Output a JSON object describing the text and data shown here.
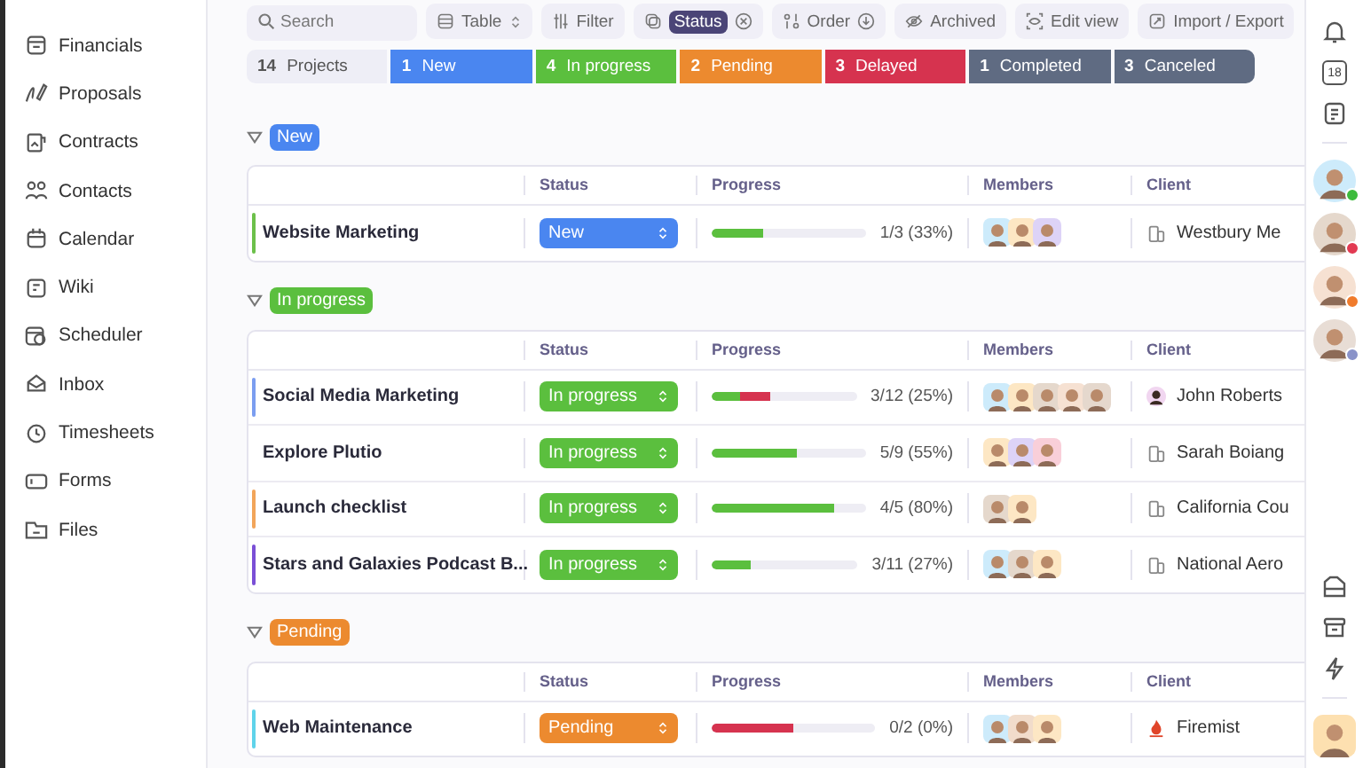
{
  "sidebar": {
    "items": [
      {
        "label": "Financials",
        "kind": "wallet"
      },
      {
        "label": "Proposals",
        "kind": "pen"
      },
      {
        "label": "Contracts",
        "kind": "document"
      },
      {
        "label": "Contacts",
        "kind": "people"
      },
      {
        "label": "Calendar",
        "kind": "calendar"
      },
      {
        "label": "Wiki",
        "kind": "note"
      },
      {
        "label": "Scheduler",
        "kind": "calendar-clock"
      },
      {
        "label": "Inbox",
        "kind": "inbox"
      },
      {
        "label": "Timesheets",
        "kind": "clock"
      },
      {
        "label": "Forms",
        "kind": "form"
      },
      {
        "label": "Files",
        "kind": "folder"
      }
    ]
  },
  "toolbar": {
    "search": {
      "placeholder": "Search"
    },
    "view": {
      "label": "Table"
    },
    "filter": {
      "label": "Filter"
    },
    "active_filter": {
      "label": "Status"
    },
    "order": {
      "label": "Order"
    },
    "archived": {
      "label": "Archived"
    },
    "edit_view": {
      "label": "Edit view"
    },
    "import_export": {
      "label": "Import / Export"
    }
  },
  "summary": [
    {
      "count": "14",
      "label": "Projects",
      "kind": "total"
    },
    {
      "count": "1",
      "label": "New",
      "kind": "new"
    },
    {
      "count": "4",
      "label": "In progress",
      "kind": "progress"
    },
    {
      "count": "2",
      "label": "Pending",
      "kind": "pending"
    },
    {
      "count": "3",
      "label": "Delayed",
      "kind": "delayed"
    },
    {
      "count": "1",
      "label": "Completed",
      "kind": "done"
    },
    {
      "count": "3",
      "label": "Canceled",
      "kind": "done"
    }
  ],
  "groups": [
    {
      "title": "New",
      "kind": "new",
      "expanded": true,
      "columns": [
        "Status",
        "Progress",
        "Members",
        "Client"
      ],
      "rows": [
        {
          "name": "Website Marketing",
          "color": "#6cc04a",
          "status": "New",
          "bar": [
            {
              "level": 0.33,
              "color": "#5bbf3e"
            }
          ],
          "progress": "1/3 (33%)",
          "members": [
            {
              "color": "#cdebfb"
            },
            {
              "color": "#fde7c4"
            },
            {
              "color": "#ddd3f7"
            }
          ],
          "client": {
            "name": "Westbury Me",
            "kind": "company"
          }
        }
      ]
    },
    {
      "title": "In progress",
      "kind": "progress",
      "expanded": true,
      "columns": [
        "Status",
        "Progress",
        "Members",
        "Client"
      ],
      "rows": [
        {
          "name": "Social Media Marketing",
          "color": "#7b9df0",
          "status": "In progress",
          "bar": [
            {
              "level": 0.2,
              "color": "#5bbf3e"
            },
            {
              "level": 0.2,
              "color": "#d6334f"
            }
          ],
          "progress": "3/12 (25%)",
          "members": [
            {
              "color": "#cdebfb"
            },
            {
              "color": "#fde7c4"
            },
            {
              "color": "#e5d8cc"
            },
            {
              "color": "#f6e1d2"
            },
            {
              "color": "#e5d8cd"
            }
          ],
          "client": {
            "name": "John Roberts",
            "kind": "person"
          }
        },
        {
          "name": "Explore Plutio",
          "status": "In progress",
          "bar": [
            {
              "level": 0.55,
              "color": "#5bbf3e"
            }
          ],
          "progress": "5/9 (55%)",
          "members": [
            {
              "color": "#fde7c4"
            },
            {
              "color": "#ddd3f7"
            },
            {
              "color": "#f9cfd9"
            }
          ],
          "client": {
            "name": "Sarah Boiang",
            "kind": "company"
          }
        },
        {
          "name": "Launch checklist",
          "color": "#f2a55a",
          "status": "In progress",
          "bar": [
            {
              "level": 0.8,
              "color": "#5bbf3e"
            }
          ],
          "progress": "4/5 (80%)",
          "members": [
            {
              "color": "#e5d8cc"
            },
            {
              "color": "#fde7c4"
            }
          ],
          "client": {
            "name": "California Cou",
            "kind": "company"
          }
        },
        {
          "name": "Stars and Galaxies Podcast B...",
          "color": "#7a4fd6",
          "status": "In progress",
          "bar": [
            {
              "level": 0.27,
              "color": "#5bbf3e"
            }
          ],
          "progress": "3/11 (27%)",
          "members": [
            {
              "color": "#cdebfb"
            },
            {
              "color": "#e5d8cc"
            },
            {
              "color": "#fde7c4"
            }
          ],
          "client": {
            "name": "National Aero",
            "kind": "company"
          }
        }
      ]
    },
    {
      "title": "Pending",
      "kind": "pending",
      "expanded": true,
      "columns": [
        "Status",
        "Progress",
        "Members",
        "Client"
      ],
      "rows": [
        {
          "name": "Web Maintenance",
          "color": "#5fd3ea",
          "status": "Pending",
          "bar": [
            {
              "level": 0.5,
              "color": "#d6334f"
            }
          ],
          "progress": "0/2 (0%)",
          "members": [
            {
              "color": "#cdebfb"
            },
            {
              "color": "#f1dccb"
            },
            {
              "color": "#fde7c4"
            }
          ],
          "client": {
            "name": "Firemist",
            "kind": "brand"
          }
        }
      ]
    }
  ],
  "rail": {
    "calendar_day": "18",
    "people": [
      {
        "color": "#3dbb3d",
        "avatar": {
          "color": "#cdebfb"
        }
      },
      {
        "color": "#e23a52",
        "avatar": {
          "color": "#e5d8cc"
        }
      },
      {
        "color": "#f07b2c",
        "avatar": {
          "color": "#f6e1d2"
        }
      },
      {
        "color": "#8a93c9",
        "avatar": {
          "color": "#e8ddd5"
        }
      }
    ],
    "me": {
      "color": "#fde0b0"
    }
  }
}
